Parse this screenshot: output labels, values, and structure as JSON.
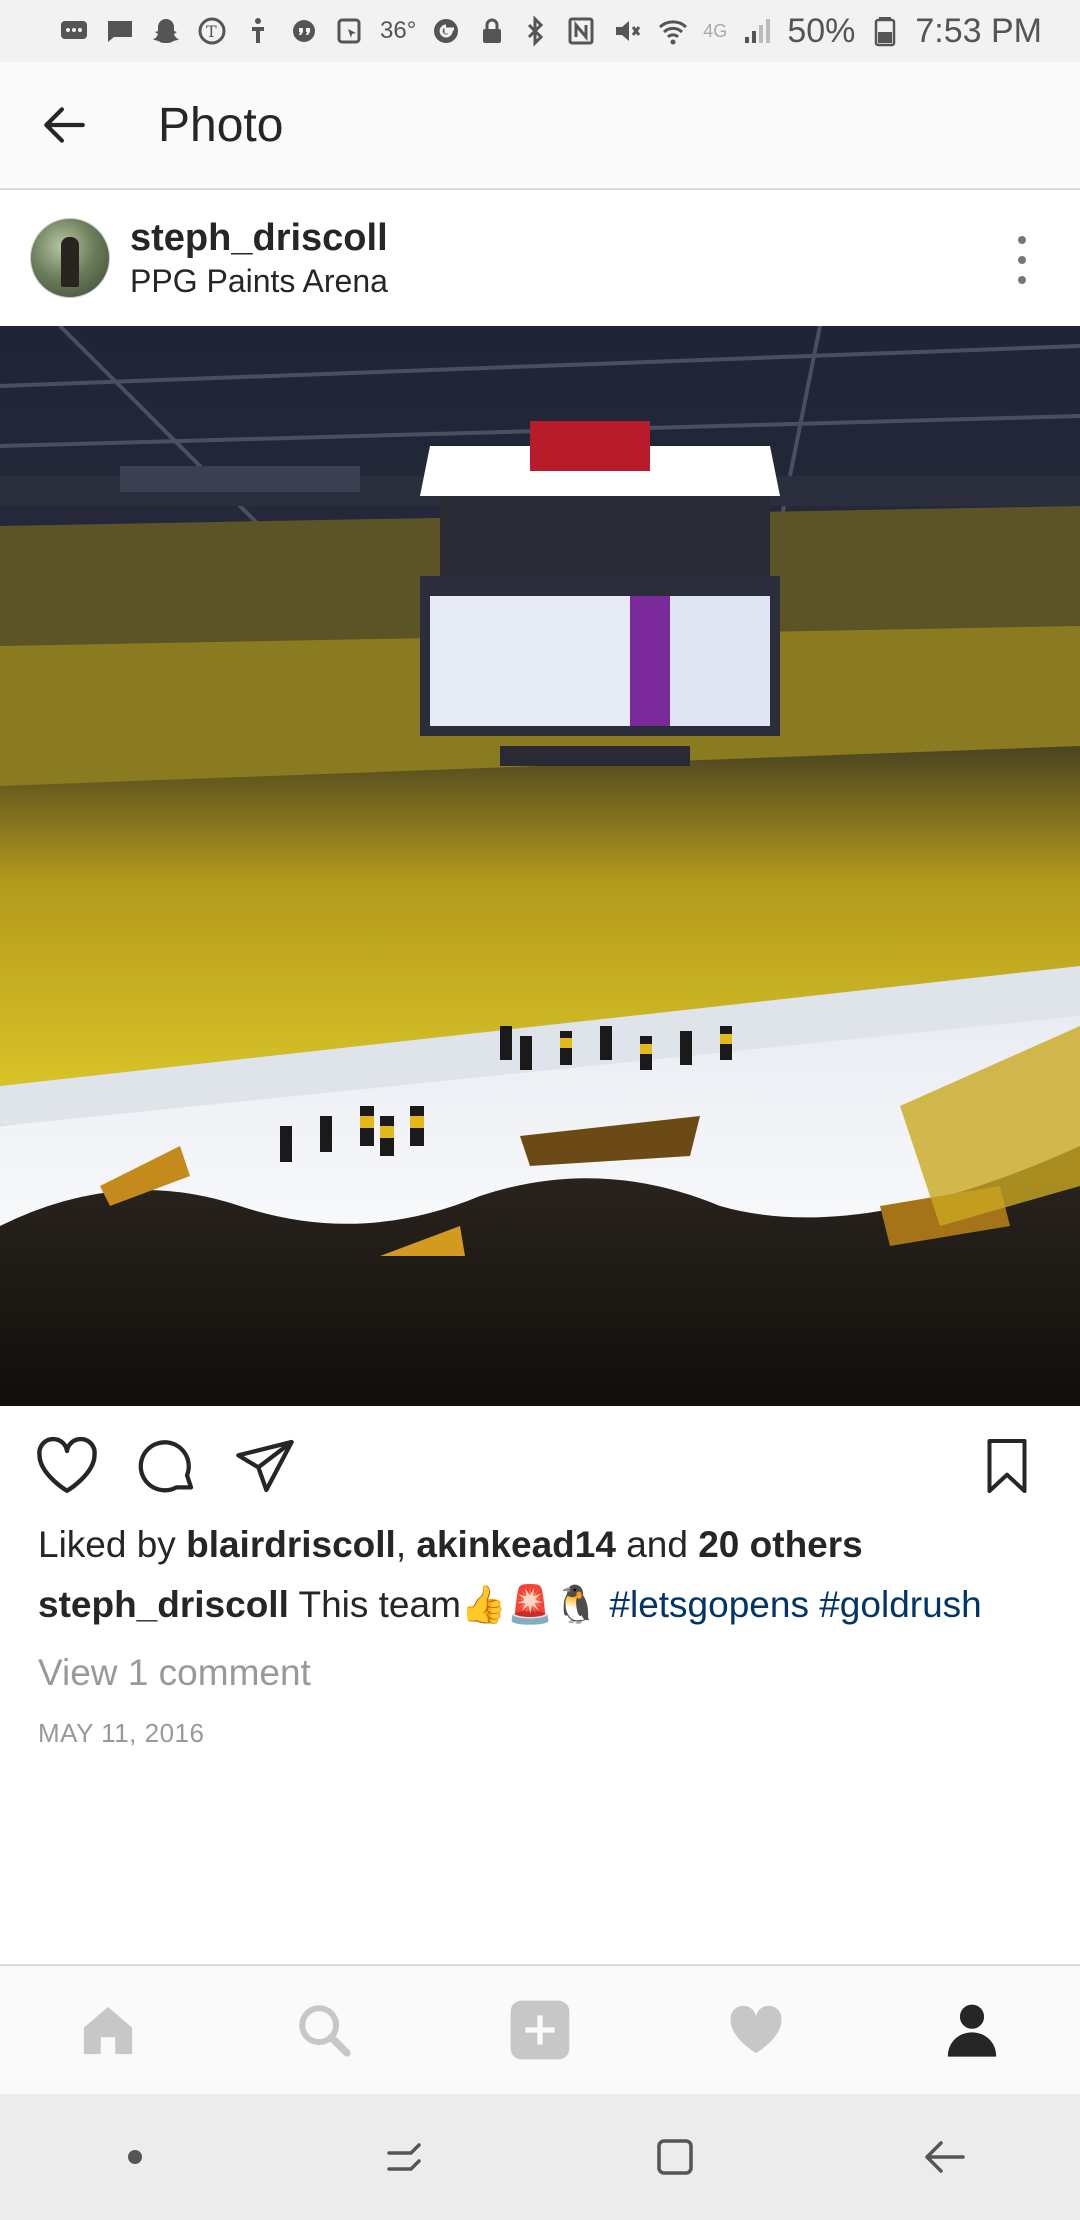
{
  "status_bar": {
    "temperature": "36°",
    "battery": "50%",
    "time": "7:53 PM",
    "network": "4G"
  },
  "header": {
    "title": "Photo"
  },
  "post": {
    "username": "steph_driscoll",
    "location": "PPG Paints Arena",
    "photo_alt": "Hockey arena celebration",
    "likes": {
      "prefix": "Liked by ",
      "user1": "blairdriscoll",
      "sep": ", ",
      "user2": "akinkead14",
      "and": " and ",
      "others": "20 others"
    },
    "caption": {
      "username": "steph_driscoll",
      "text": " This team👍🚨🐧 ",
      "hashtag1": "#letsgopens",
      "hashtag2": "#goldrush"
    },
    "view_comments": "View 1 comment",
    "date": "MAY 11, 2016"
  },
  "colors": {
    "hashtag": "#003569",
    "muted": "#999999",
    "text": "#262626"
  }
}
